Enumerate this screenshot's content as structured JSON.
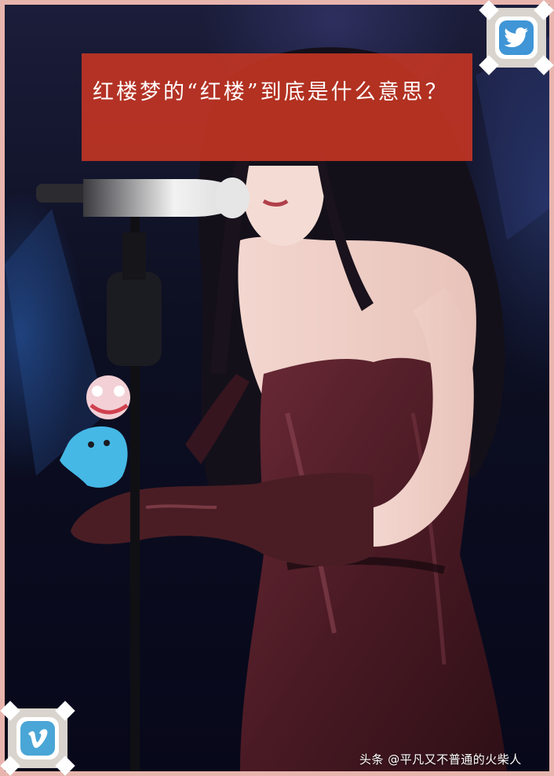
{
  "title": "红楼梦的“红楼”到底是什么意思？",
  "watermark": "头条 @平凡又不普通的火柴人",
  "icons": {
    "top_right": "twitter-icon",
    "bottom_left": "vimeo-icon"
  },
  "colors": {
    "frame": "#e8b5ae",
    "title_background": "#cd3723",
    "twitter": "#3f95d6",
    "vimeo": "#4aa6d6"
  }
}
